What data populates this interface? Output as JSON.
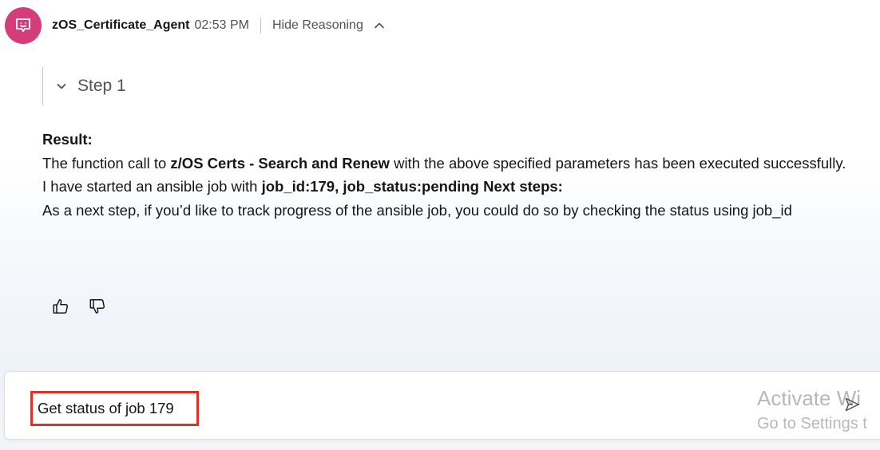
{
  "header": {
    "agent_name": "zOS_Certificate_Agent",
    "timestamp": "02:53 PM",
    "hide_reasoning_label": "Hide Reasoning",
    "avatar_icon": "chat-bot-icon",
    "avatar_color": "#d23d7a"
  },
  "reasoning": {
    "step_label": "Step 1",
    "toggle_icon": "chevron-down-icon"
  },
  "result": {
    "heading": "Result:",
    "line1_prefix": "The function call to ",
    "line1_bold": "z/OS Certs - Search and Renew",
    "line1_suffix": " with the above specified parameters has been executed successfully.",
    "line2_prefix": "I have started an ansible job with ",
    "line2_bold": "job_id:179, job_status:pending Next steps:",
    "line3": "As a next step, if you’d like to track progress of the ansible job, you could do so by checking the status using job_id"
  },
  "feedback": {
    "like_icon": "thumbs-up-icon",
    "dislike_icon": "thumbs-down-icon"
  },
  "input": {
    "value": "Get status of job 179",
    "send_icon": "send-icon",
    "highlight_color": "#d9342b"
  },
  "watermark": {
    "line1": "Activate Wi",
    "line2": "Go to Settings t"
  }
}
